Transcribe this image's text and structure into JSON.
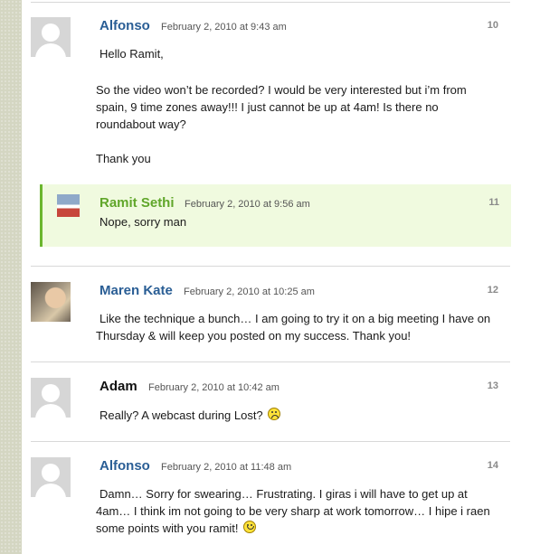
{
  "comments": [
    {
      "author": "Alfonso",
      "date": "February 2, 2010 at 9:43 am",
      "number": "10",
      "paragraphs": [
        "Hello Ramit,",
        "So the video won’t be recorded? I would be very interested but i’m from spain, 9 time zones away!!! I just cannot be up at 4am! Is there no roundabout way?",
        "Thank you"
      ]
    },
    {
      "author": "Ramit Sethi",
      "date": "February 2, 2010 at 9:56 am",
      "number": "11",
      "paragraphs": [
        "Nope, sorry man"
      ]
    },
    {
      "author": "Maren Kate",
      "date": "February 2, 2010 at 10:25 am",
      "number": "12",
      "paragraphs": [
        "Like the technique a bunch… I am going to try it on a big meeting I have on Thursday & will keep you posted on my success. Thank you!"
      ]
    },
    {
      "author": "Adam",
      "date": "February 2, 2010 at 10:42 am",
      "number": "13",
      "paragraphs": [
        "Really? A webcast during Lost?"
      ]
    },
    {
      "author": "Alfonso",
      "date": "February 2, 2010 at 11:48 am",
      "number": "14",
      "paragraphs": [
        "Damn… Sorry for swearing… Frustrating. I giras i will have to get up at 4am… I think im not going to be very sharp at work tomorrow… I hipe i raen some points with you ramit!"
      ]
    }
  ],
  "icons": {
    "default_avatar": "default-avatar-icon",
    "sad": "sad-smiley-icon",
    "wink": "wink-smiley-icon"
  },
  "colors": {
    "author_link": "#2a5e95",
    "admin_author": "#60a62a",
    "reply_background": "#f0fadf",
    "reply_border": "#6bb62f"
  }
}
